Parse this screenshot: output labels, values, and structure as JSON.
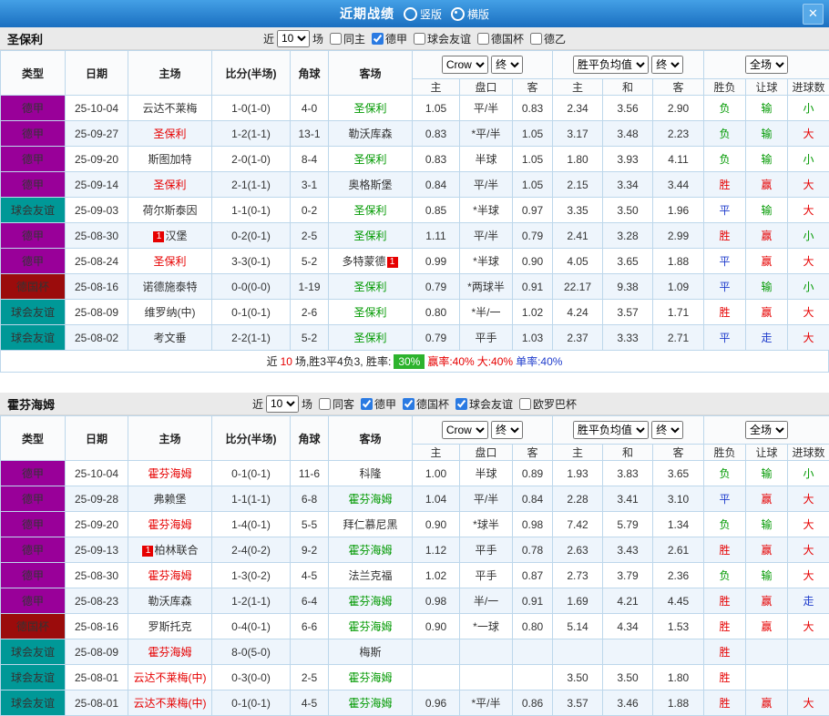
{
  "header": {
    "title": "近期战绩",
    "vertical_label": "竖版",
    "horizontal_label": "横版",
    "selected_view": "横版",
    "close_label": "✕"
  },
  "colors": {
    "type_bg": {
      "德甲": "#990099",
      "球会友谊": "#009897",
      "德国杯": "#9b0c0c"
    },
    "result_win": "#e60000",
    "result_lose": "#009900",
    "result_draw": "#1f3ccc",
    "home_focal": "#e60000",
    "away_focal": "#009900",
    "score": "#e60000",
    "win_rate_badge_bg": "#2db32d",
    "titlebar_blue": "#1a6fc0"
  },
  "table_head": {
    "main": [
      "类型",
      "日期",
      "主场",
      "比分(半场)",
      "角球",
      "客场"
    ],
    "crow_select": "Crow",
    "final_select": "终",
    "avg_select": "胜平负均值",
    "final_select2": "终",
    "scope_select": "全场",
    "sub": [
      "主",
      "盘口",
      "客",
      "主",
      "和",
      "客",
      "胜负",
      "让球",
      "进球数"
    ]
  },
  "sections": [
    {
      "team": "圣保利",
      "filter": {
        "near": "近",
        "count": "10",
        "games": "场",
        "options": [
          {
            "label": "同主",
            "checked": false
          },
          {
            "label": "德甲",
            "checked": true
          },
          {
            "label": "球会友谊",
            "checked": false
          },
          {
            "label": "德国杯",
            "checked": false
          },
          {
            "label": "德乙",
            "checked": false
          }
        ]
      },
      "rows": [
        {
          "type": "德甲",
          "date": "25-10-04",
          "home": "云达不莱梅",
          "home_color": "",
          "score": "1-0(1-0)",
          "corner": "4-0",
          "away": "圣保利",
          "away_color": "green",
          "odds_home": "1.05",
          "handicap": "平/半",
          "starred": false,
          "odds_away": "0.83",
          "avg_home": "2.34",
          "avg_draw": "3.56",
          "avg_away": "2.90",
          "result": "负",
          "result_cls": "lose",
          "let": "输",
          "let_cls": "lose",
          "goal": "小",
          "goal_cls": "lose"
        },
        {
          "type": "德甲",
          "date": "25-09-27",
          "home": "圣保利",
          "home_color": "red",
          "score": "1-2(1-1)",
          "corner": "13-1",
          "away": "勒沃库森",
          "away_color": "",
          "odds_home": "0.83",
          "handicap": "*平/半",
          "starred": true,
          "odds_away": "1.05",
          "avg_home": "3.17",
          "avg_draw": "3.48",
          "avg_away": "2.23",
          "result": "负",
          "result_cls": "lose",
          "let": "输",
          "let_cls": "lose",
          "goal": "大",
          "goal_cls": "win"
        },
        {
          "type": "德甲",
          "date": "25-09-20",
          "home": "斯图加特",
          "home_color": "",
          "score": "2-0(1-0)",
          "corner": "8-4",
          "away": "圣保利",
          "away_color": "green",
          "odds_home": "0.83",
          "handicap": "半球",
          "starred": false,
          "odds_away": "1.05",
          "avg_home": "1.80",
          "avg_draw": "3.93",
          "avg_away": "4.11",
          "result": "负",
          "result_cls": "lose",
          "let": "输",
          "let_cls": "lose",
          "goal": "小",
          "goal_cls": "lose"
        },
        {
          "type": "德甲",
          "date": "25-09-14",
          "home": "圣保利",
          "home_color": "red",
          "score": "2-1(1-1)",
          "corner": "3-1",
          "away": "奥格斯堡",
          "away_color": "",
          "odds_home": "0.84",
          "handicap": "平/半",
          "starred": false,
          "odds_away": "1.05",
          "avg_home": "2.15",
          "avg_draw": "3.34",
          "avg_away": "3.44",
          "result": "胜",
          "result_cls": "win",
          "let": "赢",
          "let_cls": "win",
          "goal": "大",
          "goal_cls": "win"
        },
        {
          "type": "球会友谊",
          "date": "25-09-03",
          "home": "荷尔斯泰因",
          "home_color": "",
          "score": "1-1(0-1)",
          "corner": "0-2",
          "away": "圣保利",
          "away_color": "green",
          "odds_home": "0.85",
          "handicap": "*半球",
          "starred": true,
          "odds_away": "0.97",
          "avg_home": "3.35",
          "avg_draw": "3.50",
          "avg_away": "1.96",
          "result": "平",
          "result_cls": "draw",
          "let": "输",
          "let_cls": "lose",
          "goal": "大",
          "goal_cls": "win"
        },
        {
          "type": "德甲",
          "date": "25-08-30",
          "home": "汉堡",
          "home_color": "",
          "home_badge": "1",
          "home_badge_pos": "before",
          "score": "0-2(0-1)",
          "corner": "2-5",
          "away": "圣保利",
          "away_color": "green",
          "odds_home": "1.11",
          "handicap": "平/半",
          "starred": false,
          "odds_away": "0.79",
          "avg_home": "2.41",
          "avg_draw": "3.28",
          "avg_away": "2.99",
          "result": "胜",
          "result_cls": "win",
          "let": "赢",
          "let_cls": "win",
          "goal": "小",
          "goal_cls": "lose"
        },
        {
          "type": "德甲",
          "date": "25-08-24",
          "home": "圣保利",
          "home_color": "red",
          "score": "3-3(0-1)",
          "corner": "5-2",
          "away": "多特蒙德",
          "away_color": "",
          "away_badge": "1",
          "away_badge_pos": "after",
          "odds_home": "0.99",
          "handicap": "*半球",
          "starred": true,
          "odds_away": "0.90",
          "avg_home": "4.05",
          "avg_draw": "3.65",
          "avg_away": "1.88",
          "result": "平",
          "result_cls": "draw",
          "let": "赢",
          "let_cls": "win",
          "goal": "大",
          "goal_cls": "win"
        },
        {
          "type": "德国杯",
          "date": "25-08-16",
          "home": "诺德施泰特",
          "home_color": "",
          "score": "0-0(0-0)",
          "corner": "1-19",
          "away": "圣保利",
          "away_color": "green",
          "odds_home": "0.79",
          "handicap": "*两球半",
          "starred": true,
          "odds_away": "0.91",
          "avg_home": "22.17",
          "avg_draw": "9.38",
          "avg_away": "1.09",
          "result": "平",
          "result_cls": "draw",
          "let": "输",
          "let_cls": "lose",
          "goal": "小",
          "goal_cls": "lose"
        },
        {
          "type": "球会友谊",
          "date": "25-08-09",
          "home": "维罗纳(中)",
          "home_color": "",
          "score": "0-1(0-1)",
          "corner": "2-6",
          "away": "圣保利",
          "away_color": "green",
          "odds_home": "0.80",
          "handicap": "*半/一",
          "starred": true,
          "odds_away": "1.02",
          "avg_home": "4.24",
          "avg_draw": "3.57",
          "avg_away": "1.71",
          "result": "胜",
          "result_cls": "win",
          "let": "赢",
          "let_cls": "win",
          "goal": "大",
          "goal_cls": "win"
        },
        {
          "type": "球会友谊",
          "date": "25-08-02",
          "home": "考文垂",
          "home_color": "",
          "score": "2-2(1-1)",
          "corner": "5-2",
          "away": "圣保利",
          "away_color": "green",
          "odds_home": "0.79",
          "handicap": "平手",
          "starred": false,
          "odds_away": "1.03",
          "avg_home": "2.37",
          "avg_draw": "3.33",
          "avg_away": "2.71",
          "result": "平",
          "result_cls": "draw",
          "let": "走",
          "let_cls": "draw",
          "goal": "大",
          "goal_cls": "win"
        }
      ],
      "summary": {
        "near": "近",
        "count": "10",
        "record": "场,胜3平4负3, 胜率:",
        "win_rate": "30%",
        "stats": [
          {
            "label": "赢率:",
            "value": "40%",
            "color": "red"
          },
          {
            "label": "大:",
            "value": "40%",
            "color": "red"
          },
          {
            "label": "单率:",
            "value": "40%",
            "color": "blue"
          }
        ]
      }
    },
    {
      "team": "霍芬海姆",
      "filter": {
        "near": "近",
        "count": "10",
        "games": "场",
        "options": [
          {
            "label": "同客",
            "checked": false
          },
          {
            "label": "德甲",
            "checked": true
          },
          {
            "label": "德国杯",
            "checked": true
          },
          {
            "label": "球会友谊",
            "checked": true
          },
          {
            "label": "欧罗巴杯",
            "checked": false
          }
        ]
      },
      "rows": [
        {
          "type": "德甲",
          "date": "25-10-04",
          "home": "霍芬海姆",
          "home_color": "red",
          "score": "0-1(0-1)",
          "corner": "11-6",
          "away": "科隆",
          "away_color": "",
          "odds_home": "1.00",
          "handicap": "半球",
          "starred": false,
          "odds_away": "0.89",
          "avg_home": "1.93",
          "avg_draw": "3.83",
          "avg_away": "3.65",
          "result": "负",
          "result_cls": "lose",
          "let": "输",
          "let_cls": "lose",
          "goal": "小",
          "goal_cls": "lose"
        },
        {
          "type": "德甲",
          "date": "25-09-28",
          "home": "弗赖堡",
          "home_color": "",
          "score": "1-1(1-1)",
          "corner": "6-8",
          "away": "霍芬海姆",
          "away_color": "green",
          "odds_home": "1.04",
          "handicap": "平/半",
          "starred": false,
          "odds_away": "0.84",
          "avg_home": "2.28",
          "avg_draw": "3.41",
          "avg_away": "3.10",
          "result": "平",
          "result_cls": "draw",
          "let": "赢",
          "let_cls": "win",
          "goal": "大",
          "goal_cls": "win"
        },
        {
          "type": "德甲",
          "date": "25-09-20",
          "home": "霍芬海姆",
          "home_color": "red",
          "score": "1-4(0-1)",
          "corner": "5-5",
          "away": "拜仁慕尼黑",
          "away_color": "",
          "odds_home": "0.90",
          "handicap": "*球半",
          "starred": true,
          "odds_away": "0.98",
          "avg_home": "7.42",
          "avg_draw": "5.79",
          "avg_away": "1.34",
          "result": "负",
          "result_cls": "lose",
          "let": "输",
          "let_cls": "lose",
          "goal": "大",
          "goal_cls": "win"
        },
        {
          "type": "德甲",
          "date": "25-09-13",
          "home": "柏林联合",
          "home_color": "",
          "home_badge": "1",
          "home_badge_pos": "before",
          "score": "2-4(0-2)",
          "corner": "9-2",
          "away": "霍芬海姆",
          "away_color": "green",
          "odds_home": "1.12",
          "handicap": "平手",
          "starred": false,
          "odds_away": "0.78",
          "avg_home": "2.63",
          "avg_draw": "3.43",
          "avg_away": "2.61",
          "result": "胜",
          "result_cls": "win",
          "let": "赢",
          "let_cls": "win",
          "goal": "大",
          "goal_cls": "win"
        },
        {
          "type": "德甲",
          "date": "25-08-30",
          "home": "霍芬海姆",
          "home_color": "red",
          "score": "1-3(0-2)",
          "corner": "4-5",
          "away": "法兰克福",
          "away_color": "",
          "odds_home": "1.02",
          "handicap": "平手",
          "starred": false,
          "odds_away": "0.87",
          "avg_home": "2.73",
          "avg_draw": "3.79",
          "avg_away": "2.36",
          "result": "负",
          "result_cls": "lose",
          "let": "输",
          "let_cls": "lose",
          "goal": "大",
          "goal_cls": "win"
        },
        {
          "type": "德甲",
          "date": "25-08-23",
          "home": "勒沃库森",
          "home_color": "",
          "score": "1-2(1-1)",
          "corner": "6-4",
          "away": "霍芬海姆",
          "away_color": "green",
          "odds_home": "0.98",
          "handicap": "半/一",
          "starred": false,
          "odds_away": "0.91",
          "avg_home": "1.69",
          "avg_draw": "4.21",
          "avg_away": "4.45",
          "result": "胜",
          "result_cls": "win",
          "let": "赢",
          "let_cls": "win",
          "goal": "走",
          "goal_cls": "draw"
        },
        {
          "type": "德国杯",
          "date": "25-08-16",
          "home": "罗斯托克",
          "home_color": "",
          "score": "0-4(0-1)",
          "corner": "6-6",
          "away": "霍芬海姆",
          "away_color": "green",
          "odds_home": "0.90",
          "handicap": "*一球",
          "starred": true,
          "odds_away": "0.80",
          "avg_home": "5.14",
          "avg_draw": "4.34",
          "avg_away": "1.53",
          "result": "胜",
          "result_cls": "win",
          "let": "赢",
          "let_cls": "win",
          "goal": "大",
          "goal_cls": "win"
        },
        {
          "type": "球会友谊",
          "date": "25-08-09",
          "home": "霍芬海姆",
          "home_color": "red",
          "score": "8-0(5-0)",
          "corner": "",
          "away": "梅斯",
          "away_color": "",
          "odds_home": "",
          "handicap": "",
          "starred": false,
          "odds_away": "",
          "avg_home": "",
          "avg_draw": "",
          "avg_away": "",
          "result": "胜",
          "result_cls": "win",
          "let": "",
          "let_cls": "",
          "goal": "",
          "goal_cls": ""
        },
        {
          "type": "球会友谊",
          "date": "25-08-01",
          "home": "云达不莱梅(中)",
          "home_color": "red",
          "score": "0-3(0-0)",
          "corner": "2-5",
          "away": "霍芬海姆",
          "away_color": "green",
          "odds_home": "",
          "handicap": "",
          "starred": false,
          "odds_away": "",
          "avg_home": "3.50",
          "avg_draw": "3.50",
          "avg_away": "1.80",
          "result": "胜",
          "result_cls": "win",
          "let": "",
          "let_cls": "",
          "goal": "",
          "goal_cls": ""
        },
        {
          "type": "球会友谊",
          "date": "25-08-01",
          "home": "云达不莱梅(中)",
          "home_color": "red",
          "score": "0-1(0-1)",
          "corner": "4-5",
          "away": "霍芬海姆",
          "away_color": "green",
          "odds_home": "0.96",
          "handicap": "*平/半",
          "starred": true,
          "odds_away": "0.86",
          "avg_home": "3.57",
          "avg_draw": "3.46",
          "avg_away": "1.88",
          "result": "胜",
          "result_cls": "win",
          "let": "赢",
          "let_cls": "win",
          "goal": "大",
          "goal_cls": "win"
        }
      ],
      "summary": null
    }
  ]
}
